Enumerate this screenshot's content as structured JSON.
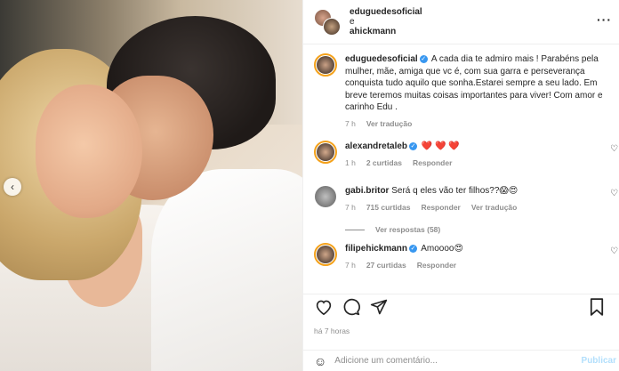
{
  "header": {
    "user1": "eduguedesoficial",
    "joiner": "e",
    "user2": "ahickmann",
    "more_icon": "more-horizontal-icon"
  },
  "caption": {
    "user": "eduguedesoficial",
    "text": "A cada dia te admiro mais ! Parabéns pela mulher, mãe, amiga que vc é, com sua garra e perseverança conquista tudo aquilo que sonha.Estarei sempre a seu lado. Em breve teremos muitas coisas importantes para viver! Com amor e carinho Edu .",
    "time": "7 h",
    "translate": "Ver tradução"
  },
  "comments": [
    {
      "user": "alexandretaleb",
      "verified": true,
      "text": "❤️ ❤️ ❤️",
      "time": "1 h",
      "likes": "2 curtidas",
      "reply": "Responder"
    },
    {
      "user": "gabi.britor",
      "verified": false,
      "text": "Será q eles vão ter filhos??😱😍",
      "time": "7 h",
      "likes": "715 curtidas",
      "reply": "Responder",
      "translate": "Ver tradução",
      "view_replies": "Ver respostas (58)"
    },
    {
      "user": "filipehickmann",
      "verified": true,
      "text": "Amoooo😍",
      "time": "7 h",
      "likes": "27 curtidas",
      "reply": "Responder"
    }
  ],
  "post_time": "há 7 horas",
  "add_comment_placeholder": "Adicione um comentário...",
  "publish_label": "Publicar"
}
